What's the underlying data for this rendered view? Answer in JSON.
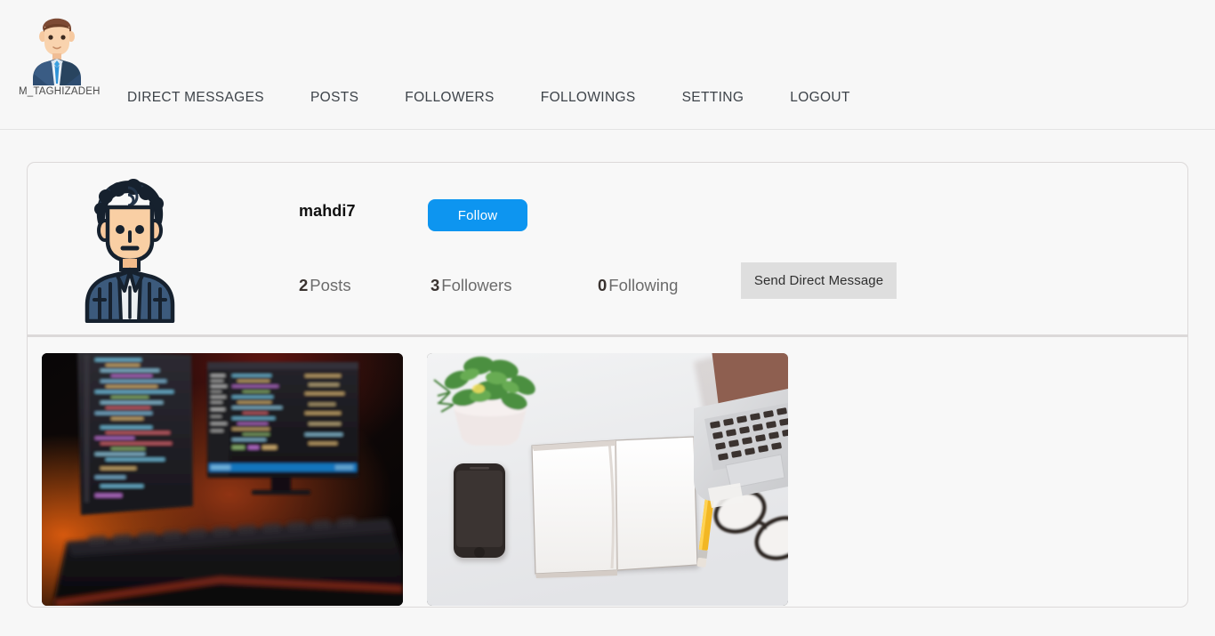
{
  "theme": {
    "page_bg": "#f7f7f7",
    "card_bg": "#f8f8f8",
    "card_border": "#dcd9d9",
    "nav_text": "#3d4349",
    "accent_blue": "#0d95f0",
    "muted_button": "#dedede",
    "stat_label": "#6b6b6b",
    "stat_number": "#3a3330"
  },
  "header": {
    "brand": {
      "avatar_icon": "user-avatar-suit-icon",
      "username": "M_TAGHIZADEH"
    },
    "nav": [
      {
        "label": "DIRECT MESSAGES",
        "name": "nav-direct-messages"
      },
      {
        "label": "POSTS",
        "name": "nav-posts"
      },
      {
        "label": "FOLLOWERS",
        "name": "nav-followers"
      },
      {
        "label": "FOLLOWINGS",
        "name": "nav-followings"
      },
      {
        "label": "SETTING",
        "name": "nav-setting"
      },
      {
        "label": "LOGOUT",
        "name": "nav-logout"
      }
    ]
  },
  "profile": {
    "avatar_icon": "user-avatar-curly-hair-icon",
    "username": "mahdi7",
    "follow_button_label": "Follow",
    "direct_message_button_label": "Send Direct Message",
    "stats": [
      {
        "count": "2",
        "label": "Posts",
        "name": "stat-posts"
      },
      {
        "count": "3",
        "label": "Followers",
        "name": "stat-followers"
      },
      {
        "count": "0",
        "label": "Following",
        "name": "stat-following"
      }
    ]
  },
  "posts": [
    {
      "name": "post-thumbnail-1",
      "alt": "Dark workspace with two monitors displaying colorful source code and a backlit mechanical keyboard with orange ambient lighting"
    },
    {
      "name": "post-thumbnail-2",
      "alt": "Bright flat-lay desk with open blank notebook, smartphone, yellow pencil, eyeglasses, laptop and a potted plant"
    }
  ]
}
